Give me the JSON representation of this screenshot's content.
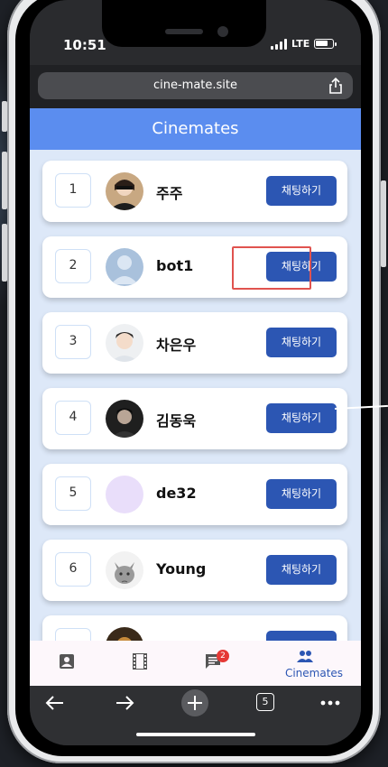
{
  "status": {
    "time": "10:51",
    "network": "LTE"
  },
  "browser": {
    "url": "cine-mate.site",
    "tab_count": "5"
  },
  "app": {
    "title": "Cinemates"
  },
  "users": [
    {
      "rank": "1",
      "name": "주주",
      "button": "채팅하기"
    },
    {
      "rank": "2",
      "name": "bot1",
      "button": "채팅하기"
    },
    {
      "rank": "3",
      "name": "차은우",
      "button": "채팅하기"
    },
    {
      "rank": "4",
      "name": "김동욱",
      "button": "채팅하기"
    },
    {
      "rank": "5",
      "name": "de32",
      "button": "채팅하기"
    },
    {
      "rank": "6",
      "name": "Young",
      "button": "채팅하기"
    }
  ],
  "nav": {
    "items": [
      {
        "icon": "profile-icon"
      },
      {
        "icon": "film-icon"
      },
      {
        "icon": "chat-icon",
        "badge": "2"
      },
      {
        "icon": "people-icon",
        "label": "Cinemates",
        "active": true
      }
    ]
  },
  "colors": {
    "header": "#5b8def",
    "button": "#2c56b3",
    "highlight": "#e0534f"
  }
}
